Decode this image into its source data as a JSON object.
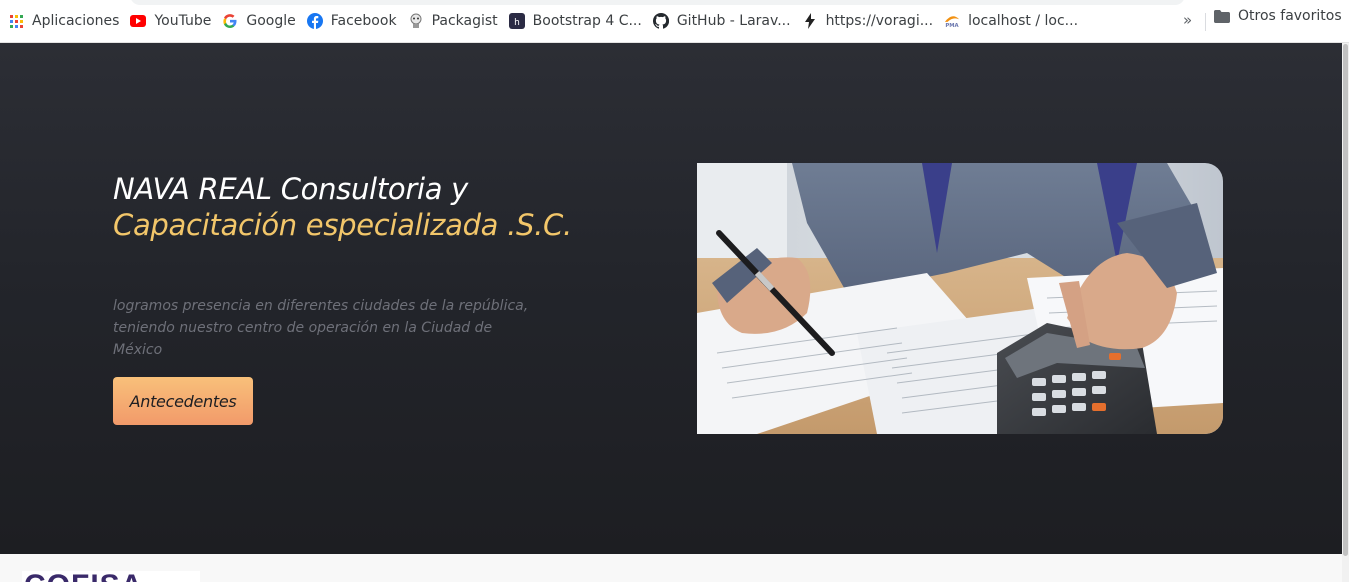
{
  "bookmarks": [
    {
      "label": "Aplicaciones",
      "icon": "apps-grid-icon"
    },
    {
      "label": "YouTube",
      "icon": "youtube-icon"
    },
    {
      "label": "Google",
      "icon": "google-icon"
    },
    {
      "label": "Facebook",
      "icon": "facebook-icon"
    },
    {
      "label": "Packagist",
      "icon": "packagist-icon"
    },
    {
      "label": "Bootstrap 4 C...",
      "icon": "bootstrap-icon"
    },
    {
      "label": "GitHub - Larav...",
      "icon": "github-icon"
    },
    {
      "label": "https://voragi...",
      "icon": "bolt-icon"
    },
    {
      "label": "localhost / loc...",
      "icon": "phpmyadmin-icon"
    }
  ],
  "bookmarks_overflow": "»",
  "other_favorites": "Otros favoritos",
  "hero": {
    "title_line1": "NAVA REAL Consultoria y",
    "title_line2": "Capacitación especializada .S.C.",
    "description": "logramos presencia en diferentes ciudades de la república, teniendo nuestro centro de operación en la Ciudad de México",
    "button_label": "Antecedentes",
    "photo_alt": "calculator-and-documents-photo"
  },
  "footer_logo_text": "COFISA",
  "colors": {
    "hero_bg": "#23252b",
    "accent_yellow": "#f2c66a",
    "button_gradient_top": "#f8c07a",
    "button_gradient_bottom": "#f29a6a",
    "muted_text": "#6e7079"
  }
}
